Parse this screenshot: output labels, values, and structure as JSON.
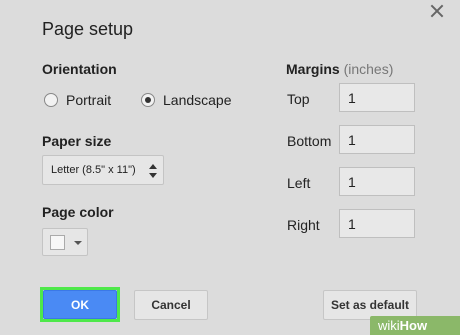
{
  "dialog": {
    "title": "Page setup",
    "close_icon": "close-icon"
  },
  "orientation": {
    "label": "Orientation",
    "options": [
      {
        "label": "Portrait",
        "selected": false
      },
      {
        "label": "Landscape",
        "selected": true
      }
    ]
  },
  "paper_size": {
    "label": "Paper size",
    "value": "Letter (8.5\" x 11\")"
  },
  "page_color": {
    "label": "Page color",
    "value": "#f7f7f7"
  },
  "margins": {
    "label": "Margins",
    "unit": "(inches)",
    "fields": [
      {
        "label": "Top",
        "value": "1"
      },
      {
        "label": "Bottom",
        "value": "1"
      },
      {
        "label": "Left",
        "value": "1"
      },
      {
        "label": "Right",
        "value": "1"
      }
    ]
  },
  "buttons": {
    "ok": "OK",
    "cancel": "Cancel",
    "set_default": "Set as default"
  },
  "watermark": {
    "brand_part1": "wiki",
    "brand_part2": "How"
  },
  "colors": {
    "primary": "#4a8af4",
    "highlight": "#4ee84a",
    "background": "#dcdcdc"
  }
}
